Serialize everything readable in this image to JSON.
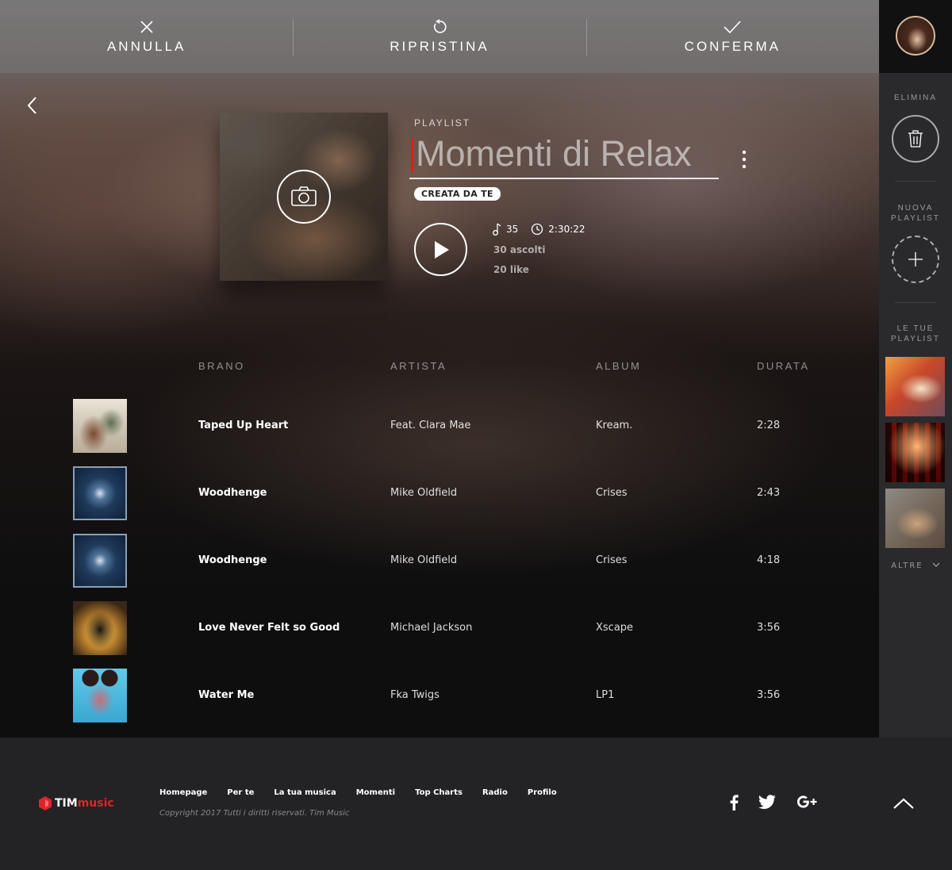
{
  "toolbar": {
    "cancel_label": "ANNULLA",
    "reset_label": "RIPRISTINA",
    "confirm_label": "CONFERMA"
  },
  "playlist": {
    "type_label": "PLAYLIST",
    "title": "Momenti di Relax",
    "badge": "CREATA DA TE",
    "track_count": "35",
    "duration": "2:30:22",
    "plays": "30 ascolti",
    "likes": "20 like"
  },
  "table": {
    "headers": {
      "track": "BRANO",
      "artist": "ARTISTA",
      "album": "ALBUM",
      "duration": "DURATA"
    },
    "rows": [
      {
        "title": "Taped Up Heart",
        "artist": "Feat. Clara Mae",
        "album": "Kream.",
        "duration": "2:28"
      },
      {
        "title": "Woodhenge",
        "artist": "Mike Oldfield",
        "album": "Crises",
        "duration": "2:43"
      },
      {
        "title": "Woodhenge",
        "artist": "Mike Oldfield",
        "album": "Crises",
        "duration": "4:18"
      },
      {
        "title": "Love Never Felt so Good",
        "artist": "Michael Jackson",
        "album": "Xscape",
        "duration": "3:56"
      },
      {
        "title": "Water Me",
        "artist": "Fka Twigs",
        "album": "LP1",
        "duration": "3:56"
      }
    ]
  },
  "sidebar": {
    "delete_label": "ELIMINA",
    "new_playlist_label_1": "NUOVA",
    "new_playlist_label_2": "PLAYLIST",
    "your_playlists_label_1": "LE TUE",
    "your_playlists_label_2": "PLAYLIST",
    "more_label": "ALTRE"
  },
  "footer": {
    "logo_tim": "TIM",
    "logo_music": "music",
    "nav": [
      "Homepage",
      "Per te",
      "La tua musica",
      "Momenti",
      "Top Charts",
      "Radio",
      "Profilo"
    ],
    "copyright": "Copyright 2017 Tutti i diritti riservati. Tim Music"
  },
  "colors": {
    "accent_red": "#e0232a",
    "cursor_red": "#d62020"
  }
}
